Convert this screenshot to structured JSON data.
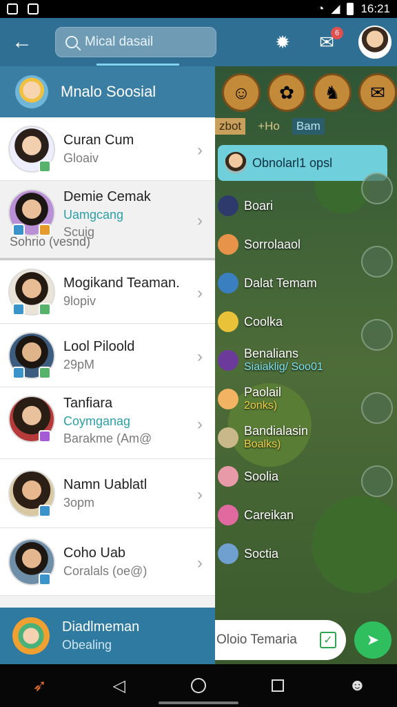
{
  "status_bar": {
    "time": "16:21"
  },
  "app_bar": {
    "search_placeholder": "Mical dasail",
    "notification_count": "6"
  },
  "drawer": {
    "header_title": "Mnalo Soosial",
    "contacts": [
      {
        "name": "Curan Cum",
        "sub": "Gloaiv"
      },
      {
        "name": "Demie Cemak",
        "accent": "Uamgcang",
        "sub": "Scuig",
        "status": "Sohrio (vesnd)"
      },
      {
        "name": "Mogikand Teaman.",
        "sub": "9lopiv"
      },
      {
        "name": "Lool Piloold",
        "sub": "29pM"
      },
      {
        "name": "Tanfiara",
        "accent": "Coymganag",
        "sub": "Barakme (Am@"
      },
      {
        "name": "Namn Uablatl",
        "sub": "3opm"
      },
      {
        "name": "Coho Uab",
        "sub": "Coralals (oe@)"
      }
    ],
    "footer_title": "Diadlmeman",
    "footer_sub": "Obealing"
  },
  "game": {
    "tabs": [
      "zbot",
      "+Ho",
      "Bam"
    ],
    "header_pill": "Obnolarl1 opsl",
    "list": [
      {
        "label": "Boari",
        "color": "#2e3a6b"
      },
      {
        "label": "Sorrolaaol",
        "color": "#e8934a"
      },
      {
        "label": "Dalat Temam",
        "color": "#3a7fc0"
      },
      {
        "label": "Coolka",
        "color": "#e9c23a"
      },
      {
        "label": "Benalians",
        "sub": "Siaiaklig/ Soo01",
        "sub_color": "#7fe3f0",
        "color": "#6b3a9a"
      },
      {
        "label": "Paolail",
        "sub": "2onks)",
        "sub_color": "#f2d24a",
        "color": "#f2b463"
      },
      {
        "label": "Bandialasin",
        "sub": "Boalks)",
        "sub_color": "#f2d24a",
        "color": "#c8b88a"
      },
      {
        "label": "Soolia",
        "color": "#e89aa8"
      },
      {
        "label": "Careikan",
        "color": "#e06aa0"
      },
      {
        "label": "Soctia",
        "color": "#6fa0d0"
      }
    ],
    "input_placeholder": "Oloio Temaria"
  }
}
